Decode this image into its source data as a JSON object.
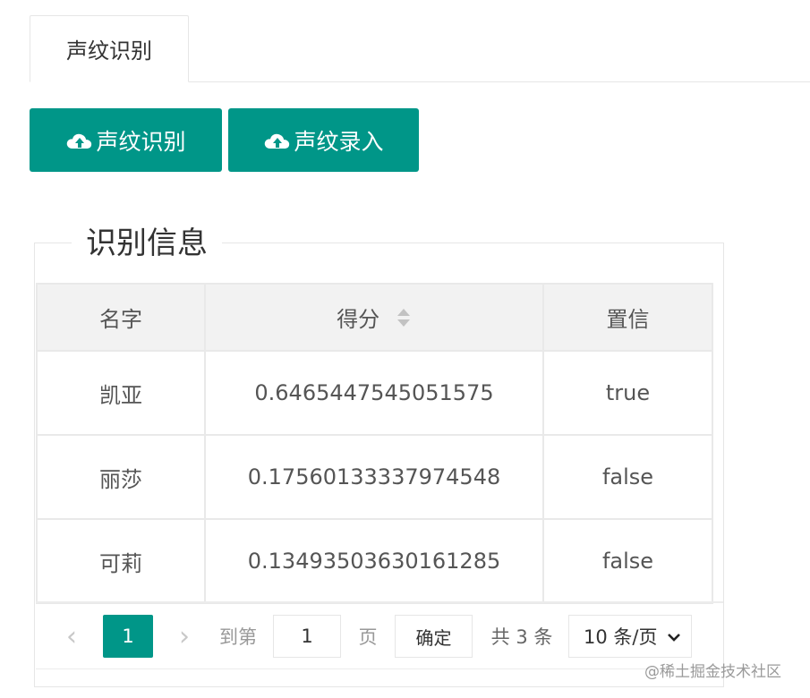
{
  "tabs": [
    {
      "label": "声纹识别"
    }
  ],
  "buttons": {
    "identify": "声纹识别",
    "enroll": "声纹录入"
  },
  "section": {
    "legend": "识别信息"
  },
  "table": {
    "headers": {
      "name": "名字",
      "score": "得分",
      "confidence": "置信"
    },
    "rows": [
      {
        "name": "凯亚",
        "score": "0.6465447545051575",
        "confidence": "true"
      },
      {
        "name": "丽莎",
        "score": "0.17560133337974548",
        "confidence": "false"
      },
      {
        "name": "可莉",
        "score": "0.13493503630161285",
        "confidence": "false"
      }
    ]
  },
  "pagination": {
    "prev": "‹",
    "current_page": "1",
    "next": "›",
    "goto_label": "到第",
    "goto_value": "1",
    "page_label": "页",
    "confirm": "确定",
    "total": "共 3 条",
    "page_size": "10 条/页"
  },
  "watermark": "@稀土掘金技术社区",
  "colors": {
    "accent": "#009688"
  },
  "icons": {
    "upload": "cloud-upload-icon",
    "sort": "sort-icon",
    "dropdown": "chevron-down-icon"
  }
}
